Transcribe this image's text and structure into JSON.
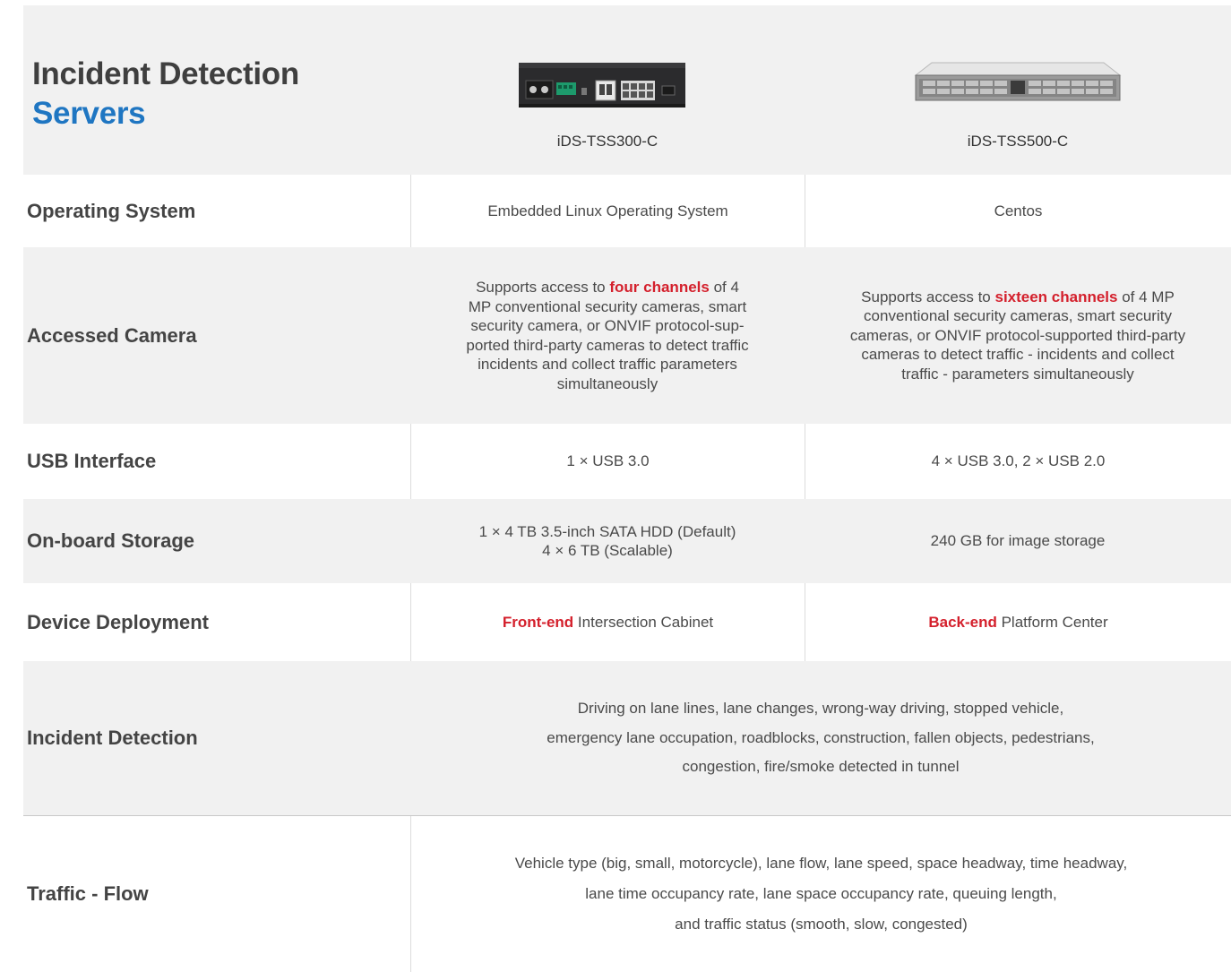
{
  "header": {
    "title_line1": "Incident Detection",
    "title_line2": "Servers",
    "products": [
      {
        "name": "iDS-TSS300-C",
        "image": "compact-server-device"
      },
      {
        "name": "iDS-TSS500-C",
        "image": "rack-server-device"
      }
    ]
  },
  "rows": {
    "os": {
      "label": "Operating System",
      "c1": "Embedded Linux Operating System",
      "c2": "Centos"
    },
    "camera": {
      "label": "Accessed Camera",
      "c1": {
        "pre": "Supports access to ",
        "highlight": "four channels",
        "post_lines": [
          " of 4",
          "MP conventional security cameras, smart",
          "security camera, or ONVIF protocol-sup-",
          "ported third-party cameras to detect traffic",
          "incidents and collect traffic parameters",
          "simultaneously"
        ]
      },
      "c2": {
        "pre": "Supports access to ",
        "highlight": "sixteen channels",
        "post_lines": [
          " of 4 MP",
          "conventional security cameras, smart security",
          "cameras, or ONVIF protocol-supported third-party",
          "cameras to detect traffic - incidents and collect",
          "traffic - parameters simultaneously"
        ]
      }
    },
    "usb": {
      "label": "USB Interface",
      "c1": "1 × USB 3.0",
      "c2": "4 × USB 3.0, 2 × USB 2.0"
    },
    "storage": {
      "label": "On-board Storage",
      "c1_lines": [
        "1 × 4 TB 3.5-inch SATA HDD (Default)",
        "4 × 6 TB (Scalable)"
      ],
      "c2": "240 GB for image storage"
    },
    "deployment": {
      "label": "Device Deployment",
      "c1_highlight": "Front-end",
      "c1_rest": " Intersection Cabinet",
      "c2_highlight": "Back-end",
      "c2_rest": " Platform Center"
    },
    "incident": {
      "label": "Incident Detection",
      "lines": [
        "Driving on lane lines,  lane changes,  wrong-way driving,  stopped vehicle,",
        "emergency lane occupation,  roadblocks,  construction,  fallen objects,  pedestrians,",
        "congestion,  fire/smoke detected in tunnel"
      ]
    },
    "flow": {
      "label": "Traffic - Flow",
      "lines": [
        "Vehicle type (big, small, motorcycle),  lane flow,  lane speed,  space headway,  time headway,",
        "lane time occupancy rate,  lane space occupancy rate,  queuing length,",
        "and traffic status (smooth, slow, congested)"
      ]
    }
  },
  "colors": {
    "accent_blue": "#1f76c2",
    "highlight_red": "#d4202c",
    "row_gray": "#f1f1f1"
  }
}
